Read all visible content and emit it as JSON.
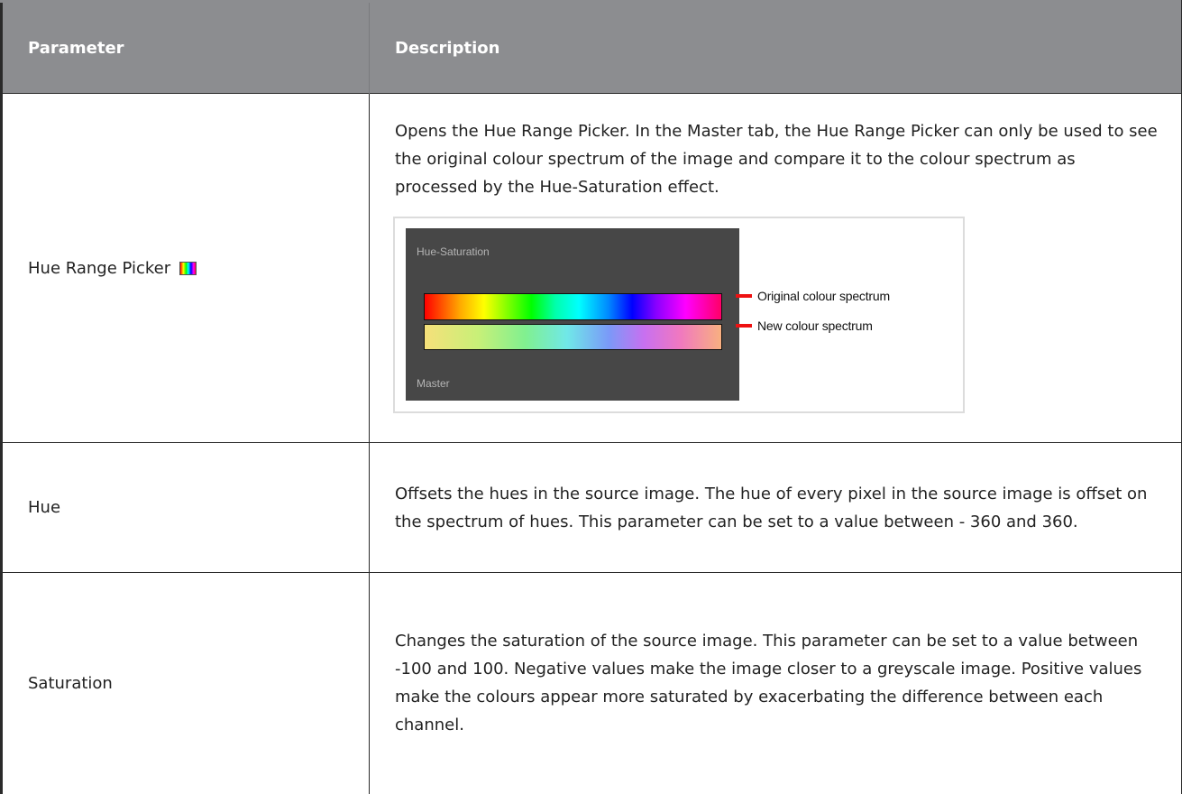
{
  "table": {
    "headers": {
      "parameter": "Parameter",
      "description": "Description"
    },
    "rows": [
      {
        "name": "Hue Range Picker",
        "icon": "hue-range-picker-icon",
        "description": "Opens the Hue Range Picker. In the Master tab, the Hue Range Picker can only be used to see the original colour spectrum of the image and compare it to the colour spectrum as processed by the Hue-Saturation effect.",
        "figure": {
          "panel_title": "Hue-Saturation",
          "panel_footer": "Master",
          "callouts": {
            "original": "Original colour spectrum",
            "new": "New colour spectrum"
          }
        }
      },
      {
        "name": "Hue",
        "description": "Offsets the hues in the source image. The hue of every pixel in the source image is offset on the spectrum of hues. This parameter can be set to a value between - 360 and 360."
      },
      {
        "name": "Saturation",
        "description": "Changes the saturation of the source image. This parameter can be set to a value between -100 and 100. Negative values make the image closer to a greyscale image. Positive values make the colours appear more saturated by exacerbating the difference between each channel."
      }
    ]
  },
  "colors": {
    "header_bg": "#8c8d90",
    "header_text": "#ffffff",
    "body_text": "#222222",
    "border": "#2a2a2a",
    "panel_bg": "#474747",
    "callout_line": "#ee1111"
  }
}
